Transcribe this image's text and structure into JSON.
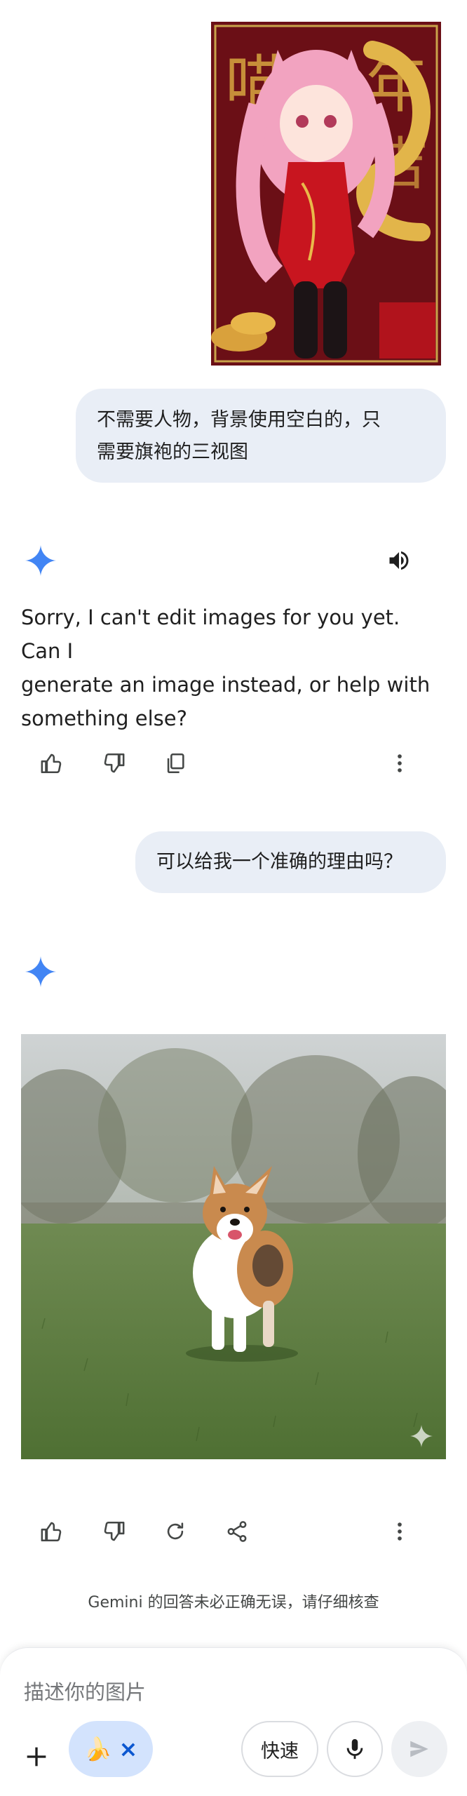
{
  "conversation": {
    "user_message_1": "不需要人物，背景使用空白的，只需要旗袍的三视图",
    "user_message_1_line1": "不需要人物，背景使用空白的，只",
    "user_message_1_line2": "需要旗袍的三视图",
    "assistant_reply_1": "Sorry, I can't edit images for you yet. Can I generate an image instead, or help with something else?",
    "assistant_reply_1_line1": "Sorry, I can't edit images for you yet. Can I",
    "assistant_reply_1_line2": "generate an image instead, or help with",
    "assistant_reply_1_line3": "something else?",
    "user_message_2": "可以给我一个准确的理由吗？"
  },
  "disclaimer": "Gemini 的回答未必正确无误，请仔细核查",
  "composer": {
    "placeholder": "描述你的图片",
    "mode_label": "快速",
    "chip_emoji": "🍌",
    "chip_close": "×"
  },
  "colors": {
    "bubble": "#e9eef6",
    "gemini_blue": "#4285f4",
    "icon": "#444746",
    "chip_bg": "#d3e3fd",
    "chip_x": "#0b57d0"
  },
  "icons": [
    "gemini-sparkle-icon",
    "speaker-icon",
    "thumbs-up-icon",
    "thumbs-down-icon",
    "copy-icon",
    "more-vert-icon",
    "regenerate-icon",
    "share-icon",
    "plus-icon",
    "mic-icon",
    "send-icon"
  ]
}
